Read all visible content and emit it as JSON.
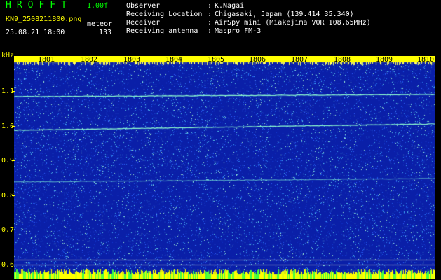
{
  "header": {
    "brand": "HROFFT",
    "version": "1.00f",
    "filename": "KN9_2508211800.png",
    "mode": "meteor",
    "datetime": "25.08.21 18:00",
    "count": "133"
  },
  "meta": [
    {
      "label": "Observer",
      "value": "K.Nagai"
    },
    {
      "label": "Receiving Location",
      "value": "Chigasaki, Japan (139.414 35.340)"
    },
    {
      "label": "Receiver",
      "value": "AirSpy mini (Miakejima VOR 108.65MHz)"
    },
    {
      "label": "Receiving antenna",
      "value": "Maspro FM-3"
    }
  ],
  "axis": {
    "unit": "kHz",
    "y_ticks": [
      "1.1",
      "1.0",
      "0.9",
      "0.8",
      "0.7",
      "0.6"
    ],
    "x_ticks": [
      "1801",
      "1802",
      "1803",
      "1804",
      "1805",
      "1806",
      "1807",
      "1808",
      "1809",
      "1810"
    ]
  },
  "colors": {
    "header_yellow": "#ffff00",
    "header_white": "#ffffff",
    "header_green": "#00ff00",
    "plot_background": "#0a1fa8",
    "signal_line": "#8fffd0",
    "top_bar": "#ffff00"
  }
}
